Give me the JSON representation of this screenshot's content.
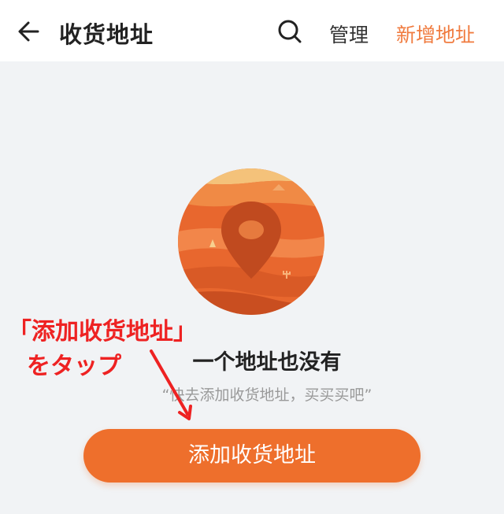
{
  "header": {
    "title": "收货地址",
    "manage_label": "管理",
    "add_new_label": "新增地址"
  },
  "empty_state": {
    "title": "一个地址也没有",
    "subtitle": "“快去添加收货地址，买买买吧”"
  },
  "action": {
    "add_address_label": "添加收货地址"
  },
  "annotation": {
    "line1": "「添加收货地址」",
    "line2": "をタップ"
  },
  "colors": {
    "accent": "#f07b3f",
    "button": "#ee6f2c",
    "annotation": "#ee2222",
    "background": "#f1f3f5"
  },
  "icons": {
    "back": "back-arrow-icon",
    "search": "search-icon",
    "illustration": "location-pin-illustration"
  }
}
